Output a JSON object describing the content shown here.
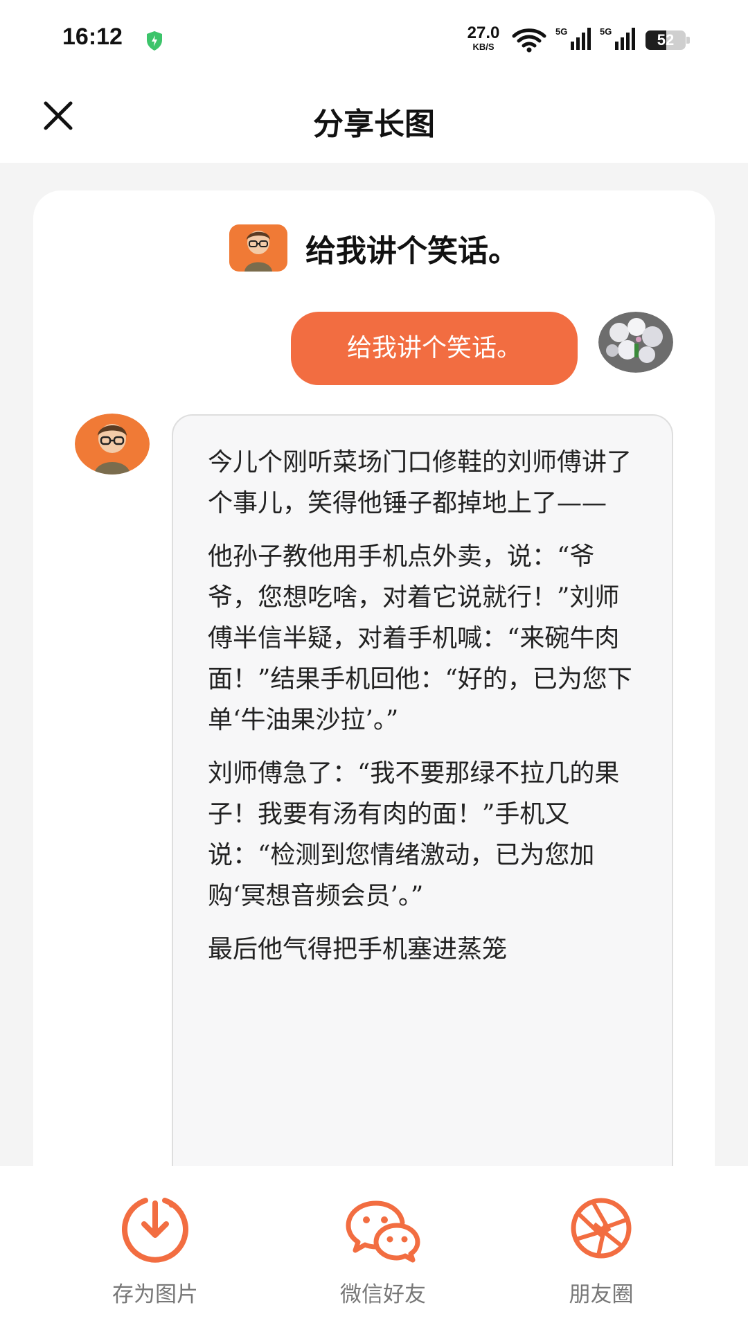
{
  "status_bar": {
    "time": "16:12",
    "net_speed_value": "27.0",
    "net_speed_unit": "KB/S",
    "signal_label": "5G",
    "battery_level": "52",
    "icons": [
      "shield-icon",
      "wifi-icon",
      "signal-icon",
      "battery-icon"
    ]
  },
  "header": {
    "title": "分享长图",
    "close_icon": "close-icon"
  },
  "card": {
    "question": "给我讲个笑话。",
    "user_message": "给我讲个笑话。",
    "bot_paragraphs": [
      "今儿个刚听菜场门口修鞋的刘师傅讲了个事儿，笑得他锤子都掉地上了——",
      "他孙子教他用手机点外卖，说：“爷爷，您想吃啥，对着它说就行！”刘师傅半信半疑，对着手机喊：“来碗牛肉面！”结果手机回他：“好的，已为您下单‘牛油果沙拉’。”",
      "刘师傅急了：“我不要那绿不拉几的果子！我要有汤有肉的面！”手机又说：“检测到您情绪激动，已为您加购‘冥想音频会员’。”",
      "最后他气得把手机塞进蒸笼"
    ]
  },
  "share_bar": {
    "save_label": "存为图片",
    "wechat_label": "微信好友",
    "moments_label": "朋友圈"
  },
  "colors": {
    "accent": "#f26d41",
    "bubble_bg": "#f7f7f8",
    "page_bg": "#f4f4f4"
  }
}
